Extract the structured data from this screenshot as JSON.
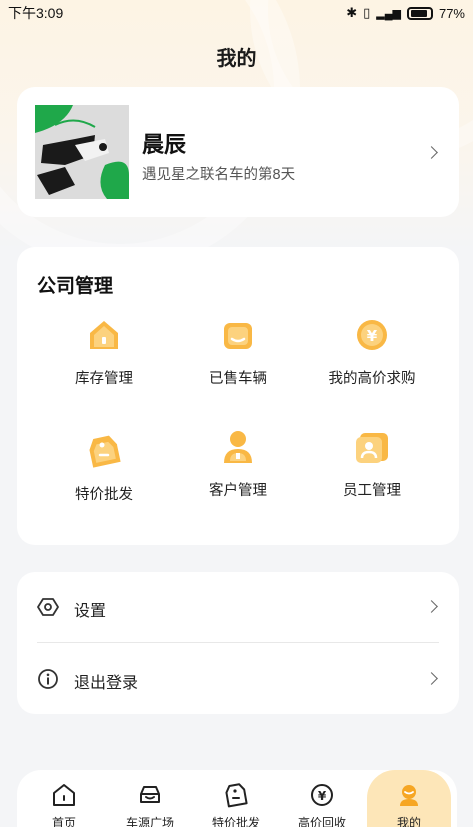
{
  "status_bar": {
    "time": "下午3:09",
    "battery": "77%"
  },
  "page_title": "我的",
  "profile": {
    "name": "晨辰",
    "subtitle": "遇见星之联名车的第8天"
  },
  "company": {
    "title": "公司管理",
    "items": [
      {
        "label": "库存管理",
        "icon": "house-icon"
      },
      {
        "label": "已售车辆",
        "icon": "sold-car-icon"
      },
      {
        "label": "我的高价求购",
        "icon": "yuan-coin-icon"
      },
      {
        "label": "特价批发",
        "icon": "price-tag-icon"
      },
      {
        "label": "客户管理",
        "icon": "customer-icon"
      },
      {
        "label": "员工管理",
        "icon": "staff-card-icon"
      }
    ]
  },
  "settings": [
    {
      "label": "设置",
      "icon": "gear-icon"
    },
    {
      "label": "退出登录",
      "icon": "info-icon"
    }
  ],
  "tabbar": [
    {
      "label": "首页",
      "icon": "home-icon"
    },
    {
      "label": "车源广场",
      "icon": "car-icon"
    },
    {
      "label": "特价批发",
      "icon": "tag-icon"
    },
    {
      "label": "高价回收",
      "icon": "yuan-icon"
    },
    {
      "label": "我的",
      "icon": "profile-icon",
      "active": true
    }
  ],
  "colors": {
    "accent": "#f6a623",
    "accent_light": "#fde6b8",
    "background": "#f4f5f7"
  }
}
